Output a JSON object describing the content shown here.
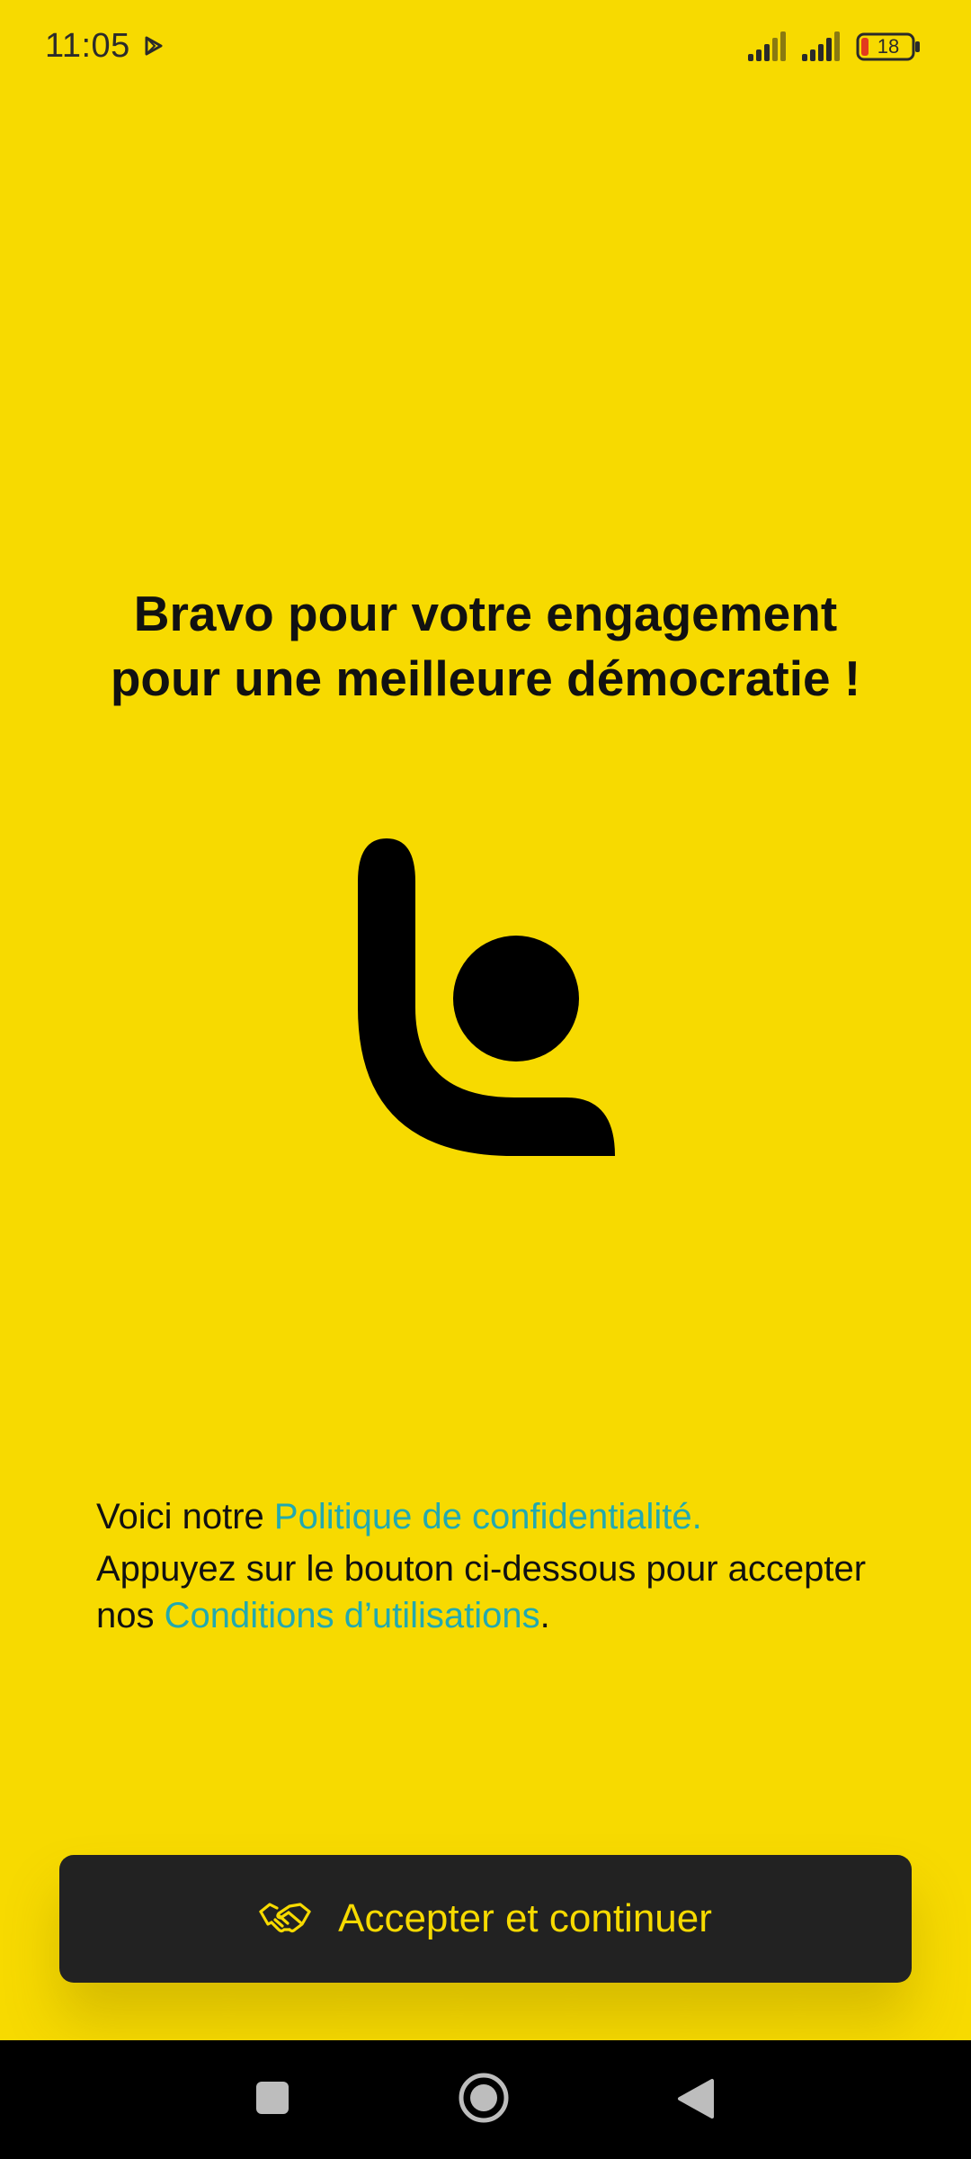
{
  "status_bar": {
    "time": "11:05",
    "battery_level": "18",
    "icons": [
      "play-store-icon",
      "signal-icon",
      "signal-icon",
      "battery-icon"
    ]
  },
  "headline": {
    "line1": "Bravo pour votre engagement",
    "line2": "pour une meilleure démocratie !"
  },
  "consent": {
    "intro": "Voici notre ",
    "privacy_link": "Politique de confidentialité.",
    "instruction": "Appuyez sur le bouton ci-dessous pour accepter nos ",
    "terms_link": "Conditions d’utilisations",
    "terms_suffix": "."
  },
  "accept_button": {
    "label": "Accepter et continuer",
    "icon": "handshake-icon"
  },
  "nav_bar": {
    "icons": [
      "recents-icon",
      "home-icon",
      "back-icon"
    ]
  },
  "colors": {
    "background": "#F7DA00",
    "button_bg": "#222222",
    "button_text": "#F7DA00",
    "link": "#22A9B0",
    "text": "#111111"
  }
}
